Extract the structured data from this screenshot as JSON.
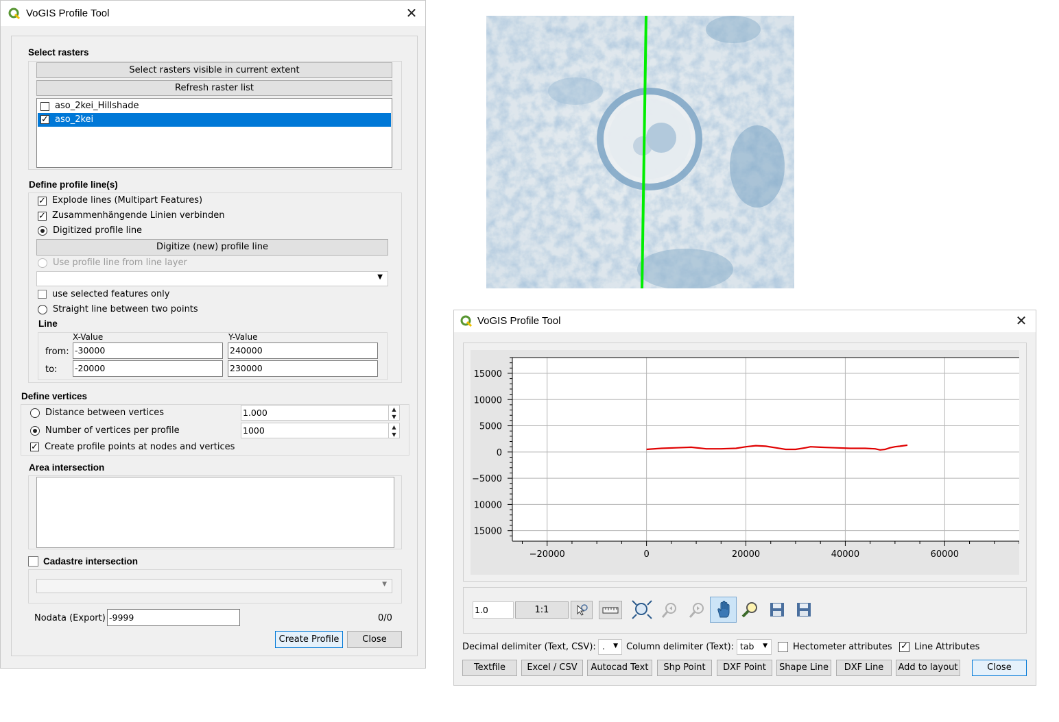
{
  "left_dialog": {
    "title": "VoGIS Profile Tool",
    "select_rasters": {
      "header": "Select rasters",
      "btn_visible": "Select rasters visible in current extent",
      "btn_refresh": "Refresh raster list",
      "rasters": [
        {
          "name": "aso_2kei_Hillshade",
          "checked": false
        },
        {
          "name": "aso_2kei",
          "checked": true,
          "selected": true
        }
      ]
    },
    "profile_lines": {
      "header": "Define profile line(s)",
      "explode": "Explode lines (Multipart Features)",
      "connect": "Zusammenhängende Linien verbinden",
      "digitized": "Digitized profile line",
      "digitize_btn": "Digitize (new) profile line",
      "use_layer": "Use profile line from line layer",
      "selected_only": "use selected features only",
      "straight": "Straight line between two points",
      "line_header": "Line",
      "x_header": "X-Value",
      "y_header": "Y-Value",
      "from_label": "from:",
      "to_label": "to:",
      "from_x": "-30000",
      "from_y": "240000",
      "to_x": "-20000",
      "to_y": "230000"
    },
    "vertices": {
      "header": "Define vertices",
      "distance_label": "Distance between vertices",
      "distance_value": "1.000",
      "number_label": "Number of vertices per profile",
      "number_value": "1000",
      "create_points": "Create profile points at nodes and vertices"
    },
    "area_header": "Area intersection",
    "cadastre_header": "Cadastre intersection",
    "nodata_label": "Nodata (Export)",
    "nodata_value": "-9999",
    "counter": "0/0",
    "create_btn": "Create Profile",
    "close_btn": "Close"
  },
  "right_dialog": {
    "title": "VoGIS Profile Tool",
    "scale_value": "1.0",
    "ratio_value": "1:1",
    "decimal_label": "Decimal delimiter (Text, CSV):",
    "decimal_value": ".",
    "column_label": "Column delimiter (Text):",
    "column_value": "tab",
    "hectometer_label": "Hectometer attributes",
    "line_attr_label": "Line Attributes",
    "buttons": [
      "Textfile",
      "Excel / CSV",
      "Autocad Text",
      "Shp Point",
      "DXF Point",
      "Shape Line",
      "DXF Line",
      "Add to layout"
    ],
    "close_btn": "Close",
    "tools": [
      "zoom-pointer-icon",
      "ruler-icon",
      "zoom-full-icon",
      "zoom-back-icon",
      "zoom-forward-icon",
      "pan-hand-icon",
      "zoom-icon",
      "save-icon",
      "save-as-icon"
    ]
  },
  "chart_data": {
    "type": "line",
    "xlim": [
      -27000,
      75000
    ],
    "ylim": [
      -17000,
      18000
    ],
    "xticks": [
      -20000,
      0,
      20000,
      40000,
      60000
    ],
    "xtick_labels": [
      "−20000",
      "0",
      "20000",
      "40000",
      "60000"
    ],
    "yticks": [
      15000,
      10000,
      5000,
      0,
      -5000,
      -10000,
      -15000
    ],
    "ytick_labels": [
      "15000",
      "10000",
      "5000",
      "0",
      "−5000",
      "10000",
      "15000"
    ],
    "grid": true,
    "series": [
      {
        "color": "#e00000",
        "x": [
          0,
          3000,
          6000,
          9000,
          12000,
          15000,
          18000,
          20000,
          22000,
          24000,
          26000,
          28000,
          30000,
          32000,
          33000,
          35000,
          38000,
          41000,
          44000,
          46000,
          47000,
          48000,
          49000,
          50000,
          51000,
          52500
        ],
        "y": [
          500,
          700,
          800,
          900,
          600,
          600,
          700,
          1000,
          1200,
          1100,
          800,
          500,
          500,
          800,
          1000,
          900,
          800,
          700,
          700,
          600,
          400,
          500,
          800,
          1000,
          1100,
          1300
        ]
      }
    ]
  },
  "map": {
    "profile_line_color": "#00ee00"
  }
}
